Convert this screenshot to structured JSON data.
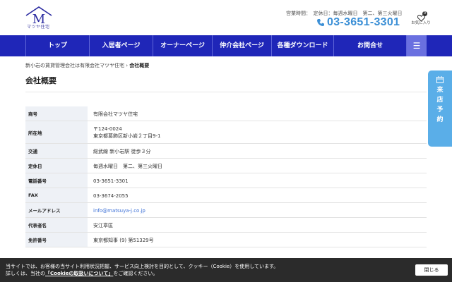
{
  "header": {
    "logo_icon": "house-m-logo",
    "logo_sub": "マツヤ住宅",
    "hours": "営業時間：　定休日：毎週水曜日　第二、第三火曜日",
    "phone": "03-3651-3301",
    "phone_icon": "phone-icon",
    "favorite_label": "お気に入り",
    "favorite_count": "0",
    "brand_color": "#1f26b8",
    "accent_color": "#3b8fd6"
  },
  "nav": {
    "items": [
      {
        "label": "トップ"
      },
      {
        "label": "入居者ページ"
      },
      {
        "label": "オーナーページ"
      },
      {
        "label": "仲介会社ページ"
      },
      {
        "label": "各種ダウンロード"
      },
      {
        "label": "お問合せ"
      }
    ],
    "menu_icon": "hamburger-icon"
  },
  "breadcrumb": {
    "home": "新小岩の賃貸管理会社は有限会社マツヤ住宅",
    "separator": "›",
    "current": "会社概要"
  },
  "page_title": "会社概要",
  "company_info": [
    {
      "label": "商号",
      "lines": [
        "有限会社マツヤ住宅"
      ]
    },
    {
      "label": "所在地",
      "lines": [
        "〒124-0024",
        "東京都葛飾区新小岩２丁目9-1"
      ]
    },
    {
      "label": "交通",
      "lines": [
        "総武線 新小岩駅 徒歩３分"
      ]
    },
    {
      "label": "定休日",
      "lines": [
        "毎週水曜日　第二、第三火曜日"
      ]
    },
    {
      "label": "電話番号",
      "lines": [
        "03-3651-3301"
      ]
    },
    {
      "label": "FAX",
      "lines": [
        "03-3674-2055"
      ]
    },
    {
      "label": "メールアドレス",
      "lines": [
        "info@matsuya-j.co.jp"
      ]
    },
    {
      "label": "代表者名",
      "lines": [
        "安江章匡"
      ]
    },
    {
      "label": "免許番号",
      "lines": [
        "東京都知事 (9) 第51329号"
      ]
    }
  ],
  "side_tab": {
    "icon": "calendar-icon",
    "chars": [
      "来",
      "店",
      "予",
      "約"
    ]
  },
  "cookie": {
    "line1": "当サイトでは、お客様の当サイト利用状況把握、サービス向上検討を目的として、クッキー（Cookie）を使用しています。",
    "line2_prefix": "詳しくは、当社の",
    "link": "「Cookieの取扱いについて」",
    "line2_suffix": "をご確認ください。",
    "close": "閉じる"
  }
}
